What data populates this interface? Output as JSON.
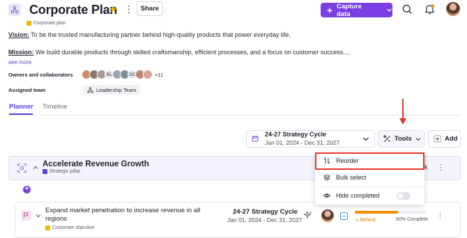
{
  "header": {
    "title": "Corporate Plan",
    "plan_type_tag": "Corporate plan",
    "share_label": "Share",
    "capture_label": "Capture data"
  },
  "statements": {
    "vision_label": "Vision:",
    "vision_text": " To be the trusted manufacturing partner behind high-quality products that power everyday life.",
    "mission_label": "Mission:",
    "mission_text": " We build durable products through skilled craftsmanship, efficient processes, and a focus on customer success....",
    "see_more": "see more"
  },
  "people": {
    "owners_label": "Owners and collaborators",
    "avatar_initials": [
      "",
      "",
      "",
      "BL",
      "",
      "",
      "DC",
      "",
      ""
    ],
    "more_count": "+11",
    "team_label": "Assigned team",
    "team_name": "Leadership Team"
  },
  "tabs": [
    "Planner",
    "Timeline"
  ],
  "toolbar": {
    "cycle_title": "24-27 Strategy Cycle",
    "cycle_dates": "Jan 01, 2024 - Dec 31, 2027",
    "tools_label": "Tools",
    "add_label": "Add"
  },
  "menu": {
    "reorder": "Reorder",
    "bulk_select": "Bulk select",
    "hide_completed": "Hide completed",
    "hidden_partial": "k"
  },
  "pillar": {
    "title": "Accelerate Revenue Growth",
    "type": "Strategic pillar"
  },
  "objective": {
    "title": "Expand market penetration to increase revenue in all regions",
    "type": "Corporate objective",
    "cycle_title": "24-27 Strategy Cycle",
    "cycle_dates": "Jan 01, 2024 - Dec 31, 2027",
    "status": "Behind",
    "progress_label": "60% Complete",
    "progress": 0.6
  },
  "colors": {
    "accent": "#7a3fe4",
    "link": "#5b3fd6",
    "pillar_tag": "#5b3fd6",
    "objective_tag": "#f5b800",
    "behind": "#f08c00",
    "highlight": "#e3352b"
  }
}
